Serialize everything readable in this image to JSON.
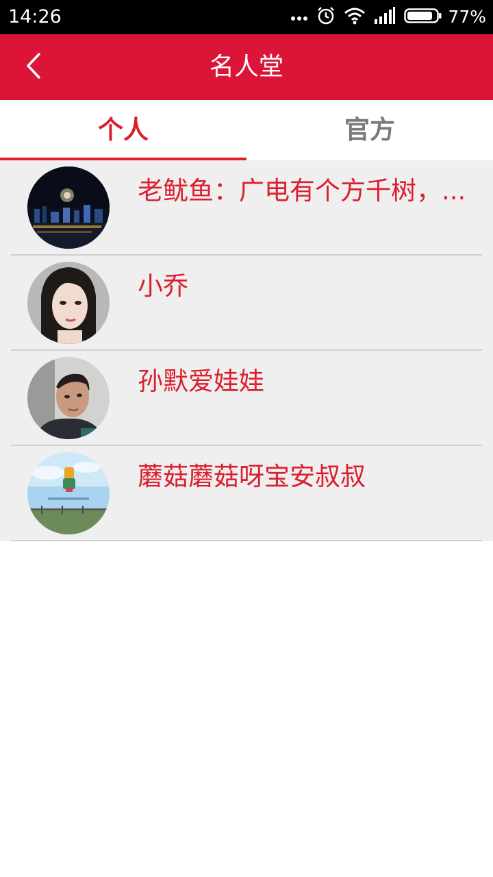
{
  "status_bar": {
    "time": "14:26",
    "battery_percent": "77%",
    "icons": [
      "more-dots-icon",
      "alarm-icon",
      "wifi-icon",
      "signal-icon",
      "battery-icon"
    ]
  },
  "header": {
    "title": "名人堂",
    "back_icon": "chevron-left-icon",
    "background_color": "#dc1437"
  },
  "tabs": [
    {
      "label": "个人",
      "active": true
    },
    {
      "label": "官方",
      "active": false
    }
  ],
  "accent_color": "#dc1e2d",
  "list": {
    "items": [
      {
        "name": "老鱿鱼：广电有个方千树，...",
        "avatar": "avatar-night-city-fireworks"
      },
      {
        "name": "小乔",
        "avatar": "avatar-woman-portrait"
      },
      {
        "name": "孙默爱娃娃",
        "avatar": "avatar-man-portrait"
      },
      {
        "name": "蘑菇蘑菇呀宝安叔叔",
        "avatar": "avatar-sky-field-cartoon"
      }
    ]
  }
}
